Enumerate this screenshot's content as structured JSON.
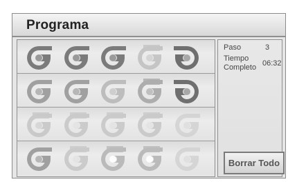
{
  "screen": {
    "title": "Programa"
  },
  "grid": {
    "rows": [
      [
        "spiral-dark",
        "spiral-dark",
        "spiral-dark",
        "spiral-light",
        "spiral-dark-alt"
      ],
      [
        "spiral-mid",
        "spiral-mid",
        "spiral-mid-light",
        "tab-mid",
        "spiral-dark-alt"
      ],
      [
        "tab-light",
        "spiral-light-shadow",
        "spiral-light-shadow",
        "spiral-light-shadow",
        "spiral-faint"
      ],
      [
        "spiral-mid",
        "spiral-light-shadow",
        "spiral-white-core",
        "spiral-white-core",
        "spiral-faint"
      ]
    ]
  },
  "info": {
    "step_label": "Paso",
    "step_value": "3",
    "time_label_line1": "Tiempo",
    "time_label_line2": "Completo",
    "time_value": "06:32"
  },
  "actions": {
    "clear_all_label": "Borrar Todo"
  },
  "colors": {
    "frame_bg": "#e6e6e6",
    "title_text": "#222222",
    "border": "#8e8e8e"
  }
}
